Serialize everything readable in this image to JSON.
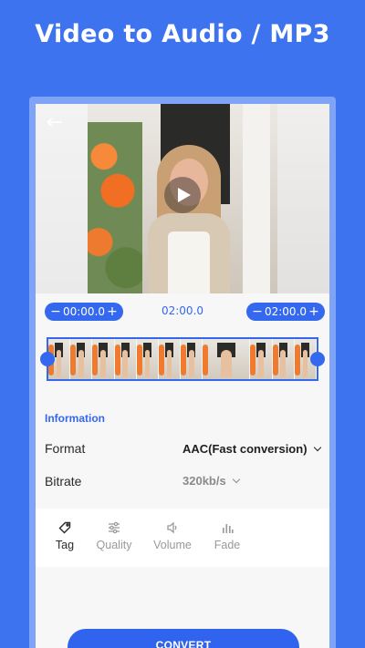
{
  "promo": {
    "title": "Video to Audio / MP3"
  },
  "player": {
    "back_icon": "←",
    "play_icon": "play-icon"
  },
  "trim": {
    "start_time": "00:00.0",
    "end_time": "02:00.0",
    "total_time": "02:00.0",
    "minus": "−",
    "plus": "+"
  },
  "information": {
    "heading": "Information",
    "format_label": "Format",
    "format_value": "AAC(Fast conversion)",
    "bitrate_label": "Bitrate",
    "bitrate_value": "320kb/s"
  },
  "tools": [
    {
      "label": "Tag",
      "icon": "tag-icon",
      "active": true
    },
    {
      "label": "Quality",
      "icon": "sliders-icon",
      "active": false
    },
    {
      "label": "Volume",
      "icon": "volume-icon",
      "active": false
    },
    {
      "label": "Fade",
      "icon": "bars-icon",
      "active": false
    }
  ],
  "actions": {
    "convert_label": "CONVERT"
  },
  "colors": {
    "background": "#3e73f0",
    "accent": "#3468ee",
    "frame": "#7fa3f6"
  }
}
